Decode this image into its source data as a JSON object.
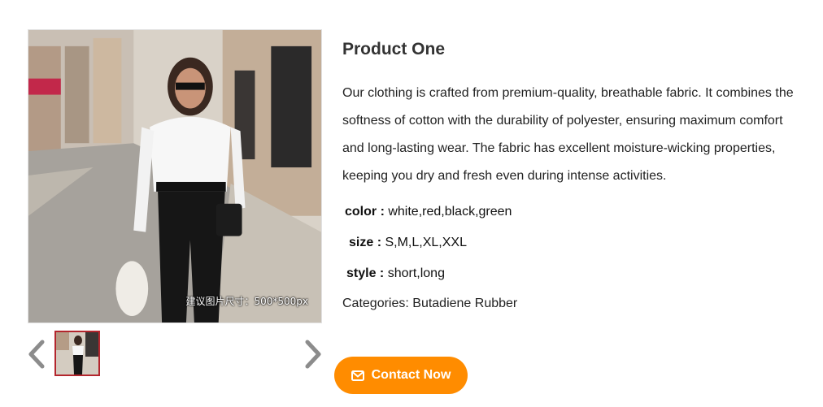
{
  "product": {
    "title": "Product One",
    "description": "Our clothing is crafted from premium-quality, breathable fabric. It combines the softness of cotton with the durability of polyester, ensuring maximum comfort and long-lasting wear. The fabric has excellent moisture-wicking properties, keeping you dry and fresh even during intense activities.",
    "image_watermark": "建议图片尺寸：500*500px",
    "attributes": {
      "color": {
        "label": "color :",
        "value": "white,red,black,green"
      },
      "size": {
        "label": "size :",
        "value": "S,M,L,XL,XXL"
      },
      "style": {
        "label": "style :",
        "value": "short,long"
      }
    },
    "categories": "Categories: Butadiene Rubber"
  },
  "gallery": {
    "prev_icon": "chevron-left-icon",
    "next_icon": "chevron-right-icon",
    "active_thumb_border": "#b3262d"
  },
  "actions": {
    "contact_label": "Contact Now",
    "contact_icon": "envelope-icon",
    "contact_color": "#ff8c00"
  }
}
